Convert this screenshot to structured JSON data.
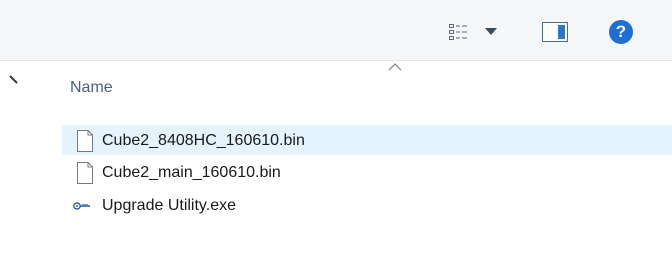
{
  "toolbar": {
    "icons": {
      "view_options": "details-view-icon",
      "dropdown": "chevron-down-icon",
      "preview_pane": "preview-pane-icon",
      "help": "help-icon"
    },
    "help_glyph": "?"
  },
  "colors": {
    "toolbar_bg": "#f5f6f7",
    "selection_bg": "#e5f3ff",
    "help_blue": "#1f6ed4",
    "header_text": "#4c607a"
  },
  "columns": {
    "name_label": "Name",
    "sort": "ascending"
  },
  "files": [
    {
      "name": "Cube2_8408HC_160610.bin",
      "icon": "blank-file-icon",
      "selected": true
    },
    {
      "name": "Cube2_main_160610.bin",
      "icon": "blank-file-icon",
      "selected": false
    },
    {
      "name": "Upgrade Utility.exe",
      "icon": "application-icon",
      "selected": false
    }
  ]
}
